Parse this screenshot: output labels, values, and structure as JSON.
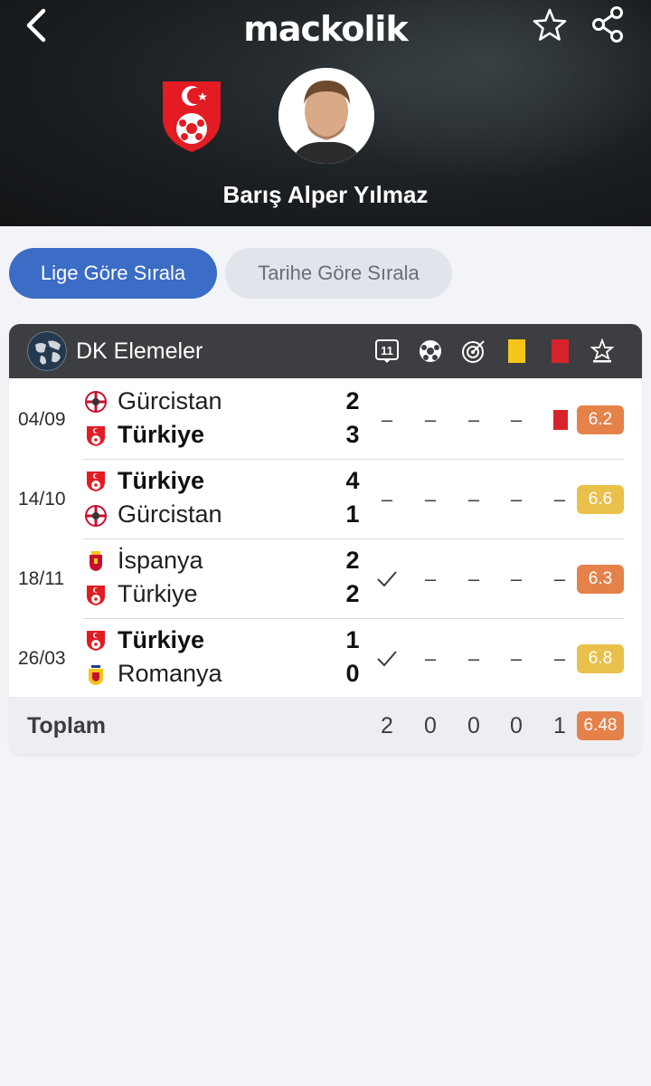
{
  "header": {
    "app_logo": "mackolik",
    "player_name": "Barış Alper Yılmaz",
    "icons": {
      "back": "chevron-left-icon",
      "favorite": "star-outline-icon",
      "share": "share-icon"
    }
  },
  "sort": {
    "by_league": "Lige Göre Sırala",
    "by_date": "Tarihe Göre Sırala"
  },
  "league": {
    "name": "DK Elemeler",
    "columns": [
      "lineup-icon",
      "goal-icon",
      "assist-icon",
      "yellow-card-icon",
      "red-card-icon",
      "rating-icon"
    ]
  },
  "matches": [
    {
      "date": "04/09",
      "home": "Gürcistan",
      "away": "Türkiye",
      "home_score": "2",
      "away_score": "3",
      "bold": "away",
      "stats": [
        "–",
        "–",
        "–",
        "–"
      ],
      "red_card": true,
      "lineup_check": false,
      "rating": "6.2",
      "rating_color": "#e4824a"
    },
    {
      "date": "14/10",
      "home": "Türkiye",
      "away": "Gürcistan",
      "home_score": "4",
      "away_score": "1",
      "bold": "home",
      "stats": [
        "–",
        "–",
        "–",
        "–",
        "–"
      ],
      "red_card": false,
      "lineup_check": false,
      "rating": "6.6",
      "rating_color": "#e9c04a"
    },
    {
      "date": "18/11",
      "home": "İspanya",
      "away": "Türkiye",
      "home_score": "2",
      "away_score": "2",
      "bold": "none",
      "stats": [
        "–",
        "–",
        "–",
        "–"
      ],
      "red_card": false,
      "lineup_check": true,
      "rating": "6.3",
      "rating_color": "#e4824a"
    },
    {
      "date": "26/03",
      "home": "Türkiye",
      "away": "Romanya",
      "home_score": "1",
      "away_score": "0",
      "bold": "home",
      "stats": [
        "–",
        "–",
        "–",
        "–"
      ],
      "red_card": false,
      "lineup_check": true,
      "rating": "6.8",
      "rating_color": "#e9c04a"
    }
  ],
  "total": {
    "label": "Toplam",
    "values": [
      "2",
      "0",
      "0",
      "0",
      "1"
    ],
    "rating": "6.48",
    "rating_color": "#e4824a"
  },
  "colors": {
    "accent": "#3b6cc6",
    "yellow_card": "#f5c518",
    "red_card": "#d8232a",
    "header_bg": "#3c3e42"
  }
}
